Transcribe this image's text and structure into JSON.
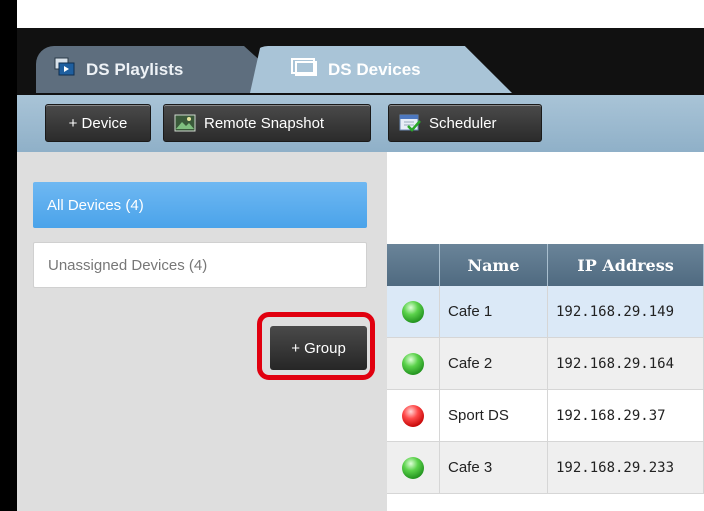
{
  "tabs": [
    {
      "label": "DS Playlists",
      "icon": "playlist-icon"
    },
    {
      "label": "DS Devices",
      "icon": "devices-icon"
    }
  ],
  "toolbar": {
    "add_device": "+ Device",
    "remote_snapshot": "Remote Snapshot",
    "scheduler": "Scheduler"
  },
  "sidebar": {
    "items": [
      {
        "label": "All Devices (4)"
      },
      {
        "label": "Unassigned Devices (4)"
      }
    ],
    "add_group": "+ Group"
  },
  "table": {
    "headers": [
      "",
      "Name",
      "IP Address"
    ],
    "rows": [
      {
        "status": "green",
        "name": "Cafe 1",
        "ip": "192.168.29.149"
      },
      {
        "status": "green",
        "name": "Cafe 2",
        "ip": "192.168.29.164"
      },
      {
        "status": "red",
        "name": "Sport DS",
        "ip": "192.168.29.37"
      },
      {
        "status": "green",
        "name": "Cafe 3",
        "ip": "192.168.29.233"
      }
    ]
  },
  "colors": {
    "accent_blue": "#4aa3ea",
    "highlight_red": "#e1000f",
    "status_green": "#2aa82a",
    "status_red": "#d60000"
  }
}
